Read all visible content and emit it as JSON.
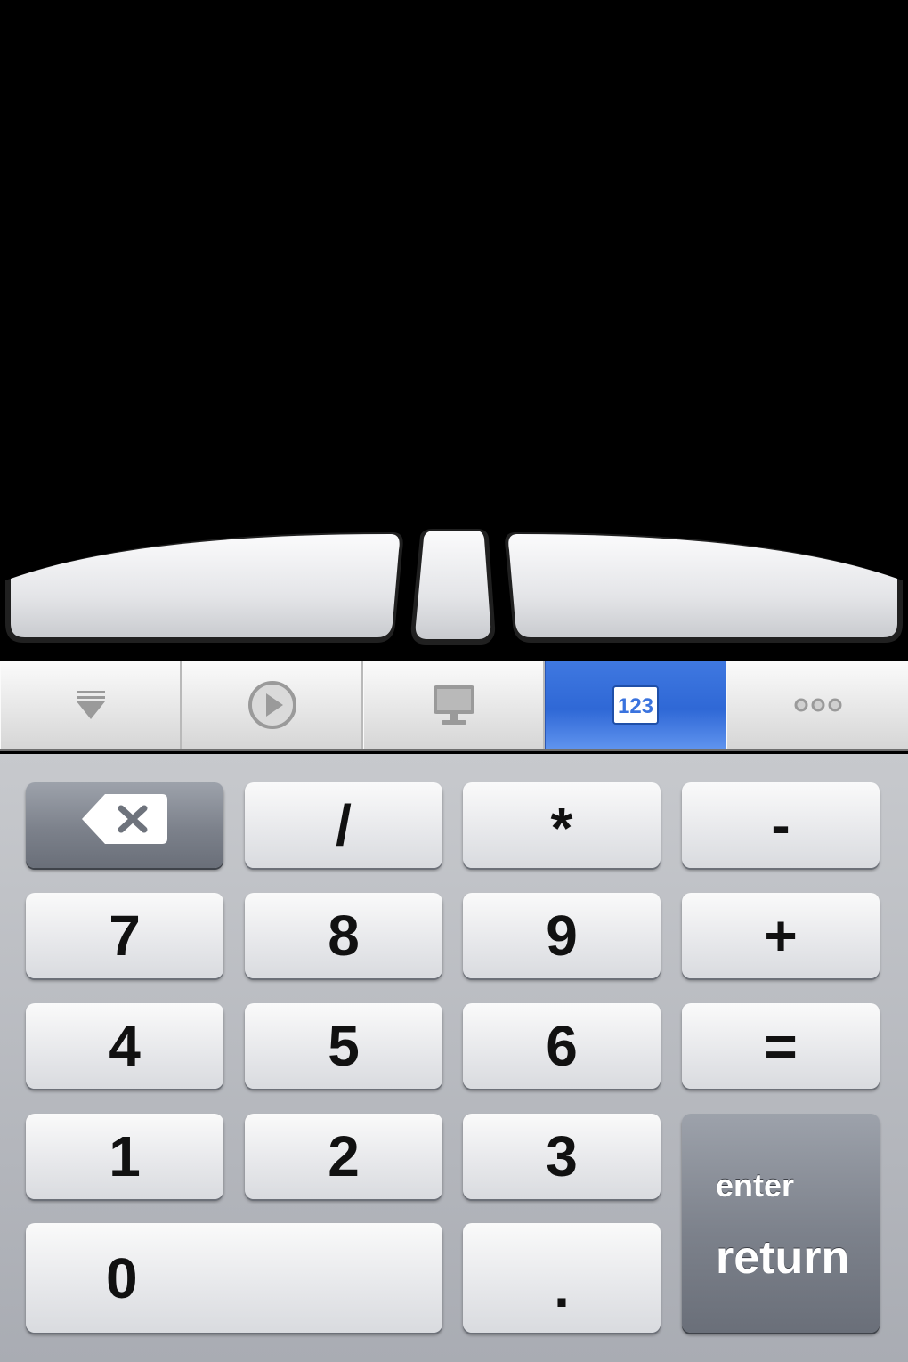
{
  "tabs": [
    {
      "icon": "keyboard-hide-icon",
      "active": false
    },
    {
      "icon": "play-icon",
      "active": false
    },
    {
      "icon": "monitor-icon",
      "active": false
    },
    {
      "icon": "numeric-keypad-icon",
      "label": "123",
      "active": true
    },
    {
      "icon": "more-icon",
      "active": false
    }
  ],
  "colors": {
    "accent": "#3a73de",
    "background": "#000000",
    "key_light": "#e6e7ea",
    "key_dark": "#7c818b"
  },
  "keypad": {
    "backspace_icon": "backspace-icon",
    "keys": {
      "slash": "/",
      "multiply": "*",
      "minus": "-",
      "seven": "7",
      "eight": "8",
      "nine": "9",
      "plus": "+",
      "four": "4",
      "five": "5",
      "six": "6",
      "equals": "=",
      "one": "1",
      "two": "2",
      "three": "3",
      "zero": "0",
      "dot": "."
    },
    "return_key": {
      "top_label": "enter",
      "bottom_label": "return"
    }
  }
}
